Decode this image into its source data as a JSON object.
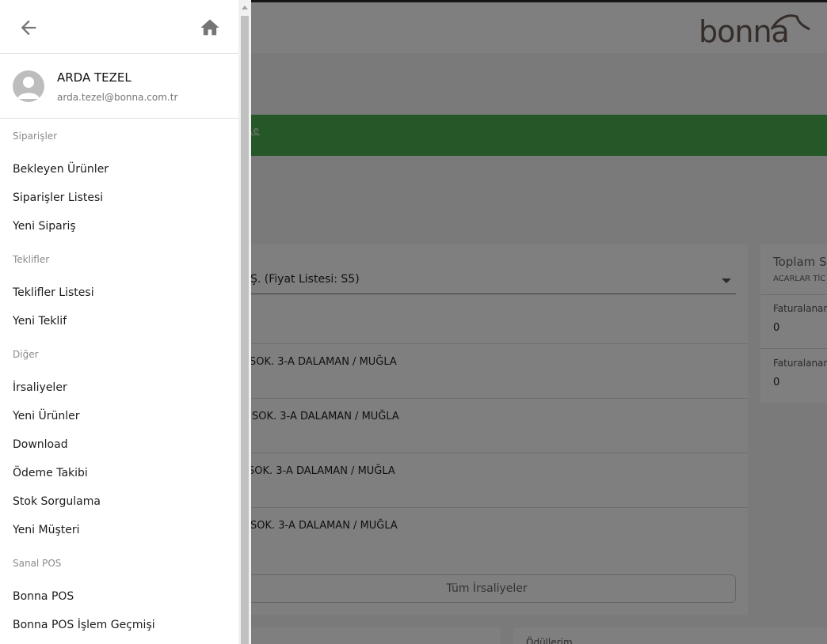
{
  "app": {
    "brand": "bonna",
    "notice_link": "...el",
    "customer_select_value": "Ş.  (Fiyat Listesi: S5)",
    "addresses": [
      "SOK. 3-A DALAMAN / MUĞLA",
      "SOK. 3-A DALAMAN / MUĞLA",
      "SOK. 3-A DALAMAN / MUĞLA",
      "SOK. 3-A DALAMAN / MUĞLA"
    ],
    "all_button": "Tüm İrsaliyeler",
    "side_card": {
      "title": "Toplam Sa",
      "subtitle": "ACARLAR TİC",
      "row1_label": "Faturalanan",
      "row1_value": "0",
      "row2_label": "Faturalanan",
      "row2_value": "0"
    },
    "bottom_card_label": "Ödüllerim"
  },
  "drawer": {
    "user": {
      "name": "ARDA TEZEL",
      "email": "arda.tezel@bonna.com.tr"
    },
    "sections": {
      "siparisler": "Siparişler",
      "teklifler": "Teklifler",
      "diger": "Diğer",
      "sanal_pos": "Sanal POS"
    },
    "items": {
      "bekleyen_urunler": "Bekleyen Ürünler",
      "siparisler_listesi": "Siparişler Listesi",
      "yeni_siparis": "Yeni Sipariş",
      "teklifler_listesi": "Teklifler Listesi",
      "yeni_teklif": "Yeni Teklif",
      "irsaliyeler": "İrsaliyeler",
      "yeni_urunler": "Yeni Ürünler",
      "download": "Download",
      "odeme_takibi": "Ödeme Takibi",
      "stok_sorgulama": "Stok Sorgulama",
      "yeni_musteri": "Yeni Müşteri",
      "bonna_pos": "Bonna POS",
      "bonna_pos_gecmis": "Bonna POS İşlem Geçmişi"
    }
  },
  "colors": {
    "brand_logo": "#6b5a55",
    "notice_green": "#4caf50",
    "overlay": "rgba(0,0,0,0.5)",
    "icon_gray": "#757575"
  },
  "icons": {
    "back": "arrow-left-icon",
    "home": "home-icon",
    "avatar": "person-icon",
    "dropdown": "caret-down-icon"
  }
}
